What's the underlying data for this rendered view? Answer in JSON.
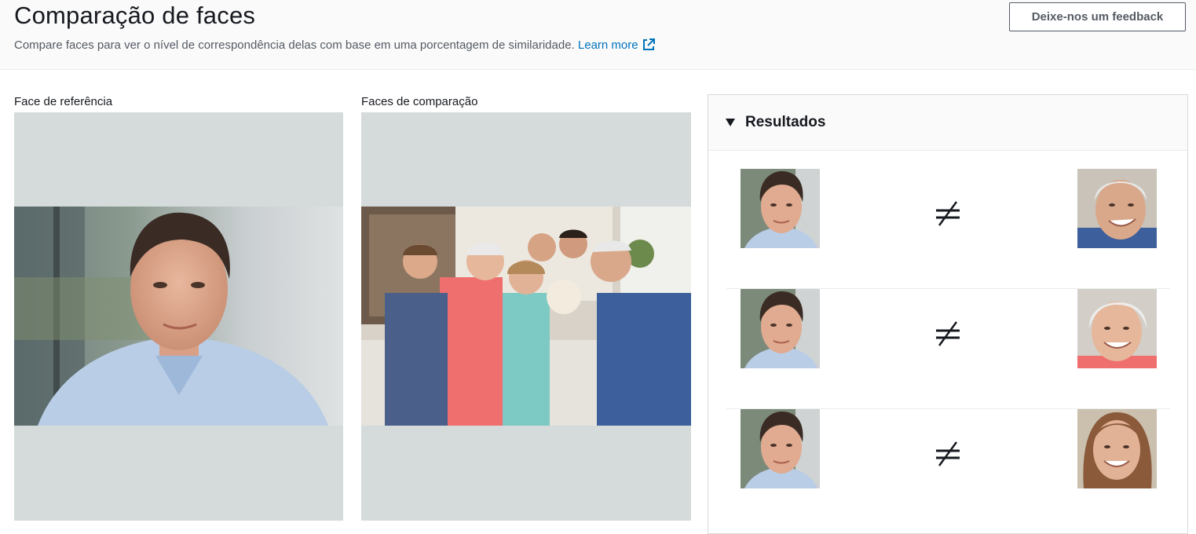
{
  "header": {
    "title": "Comparação de faces",
    "description": "Compare faces para ver o nível de correspondência delas com base em uma porcentagem de similaridade.",
    "learn_more": "Learn more",
    "feedback_button": "Deixe-nos um feedback"
  },
  "reference": {
    "label": "Face de referência"
  },
  "comparison": {
    "label": "Faces de comparação"
  },
  "results": {
    "title": "Resultados",
    "rows": [
      {
        "match": false,
        "symbol": "not-equal"
      },
      {
        "match": false,
        "symbol": "not-equal"
      },
      {
        "match": false,
        "symbol": "not-equal"
      }
    ]
  },
  "colors": {
    "link": "#0073bb",
    "placeholder_bg": "#d5dbdb",
    "text": "#16191f"
  }
}
